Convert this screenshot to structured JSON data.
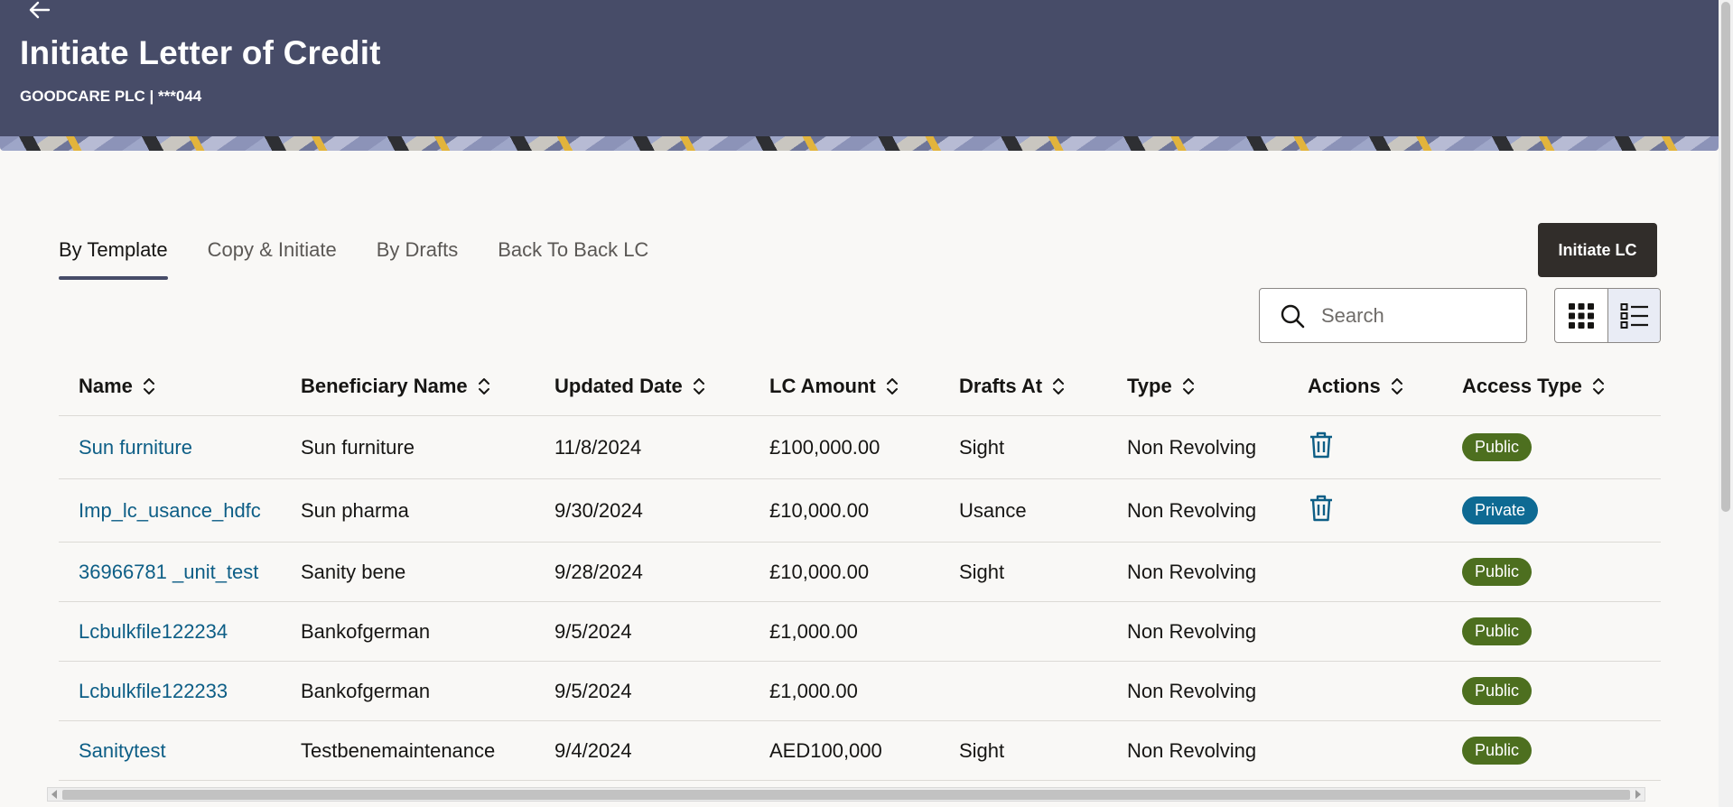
{
  "header": {
    "title": "Initiate Letter of Credit",
    "subtitle": "GOODCARE PLC | ***044",
    "back_icon": "arrow-left-icon"
  },
  "tabs": [
    {
      "label": "By Template",
      "active": true
    },
    {
      "label": "Copy & Initiate",
      "active": false
    },
    {
      "label": "By Drafts",
      "active": false
    },
    {
      "label": "Back To Back LC",
      "active": false
    }
  ],
  "toolbar": {
    "initiate_label": "Initiate LC",
    "search_placeholder": "Search",
    "search_value": "",
    "view_mode": "list"
  },
  "table": {
    "columns": [
      "Name",
      "Beneficiary Name",
      "Updated Date",
      "LC Amount",
      "Drafts At",
      "Type",
      "Actions",
      "Access Type"
    ],
    "rows": [
      {
        "name": "Sun furniture",
        "beneficiary": "Sun furniture",
        "updated": "11/8/2024",
        "amount": "£100,000.00",
        "drafts_at": "Sight",
        "type": "Non Revolving",
        "deletable": true,
        "access": "Public"
      },
      {
        "name": "Imp_lc_usance_hdfc",
        "beneficiary": "Sun pharma",
        "updated": "9/30/2024",
        "amount": "£10,000.00",
        "drafts_at": "Usance",
        "type": "Non Revolving",
        "deletable": true,
        "access": "Private"
      },
      {
        "name": "36966781 _unit_test",
        "beneficiary": "Sanity bene",
        "updated": "9/28/2024",
        "amount": "£10,000.00",
        "drafts_at": "Sight",
        "type": "Non Revolving",
        "deletable": false,
        "access": "Public"
      },
      {
        "name": "Lcbulkfile122234",
        "beneficiary": "Bankofgerman",
        "updated": "9/5/2024",
        "amount": "£1,000.00",
        "drafts_at": "",
        "type": "Non Revolving",
        "deletable": false,
        "access": "Public"
      },
      {
        "name": "Lcbulkfile122233",
        "beneficiary": "Bankofgerman",
        "updated": "9/5/2024",
        "amount": "£1,000.00",
        "drafts_at": "",
        "type": "Non Revolving",
        "deletable": false,
        "access": "Public"
      },
      {
        "name": "Sanitytest",
        "beneficiary": "Testbenemaintenance",
        "updated": "9/4/2024",
        "amount": "AED100,000",
        "drafts_at": "Sight",
        "type": "Non Revolving",
        "deletable": false,
        "access": "Public"
      }
    ]
  },
  "colors": {
    "header_bg": "#474c68",
    "link": "#0d5e86",
    "public_badge": "#4d6f1f",
    "private_badge": "#0e6a93",
    "primary_button": "#312d2a"
  }
}
